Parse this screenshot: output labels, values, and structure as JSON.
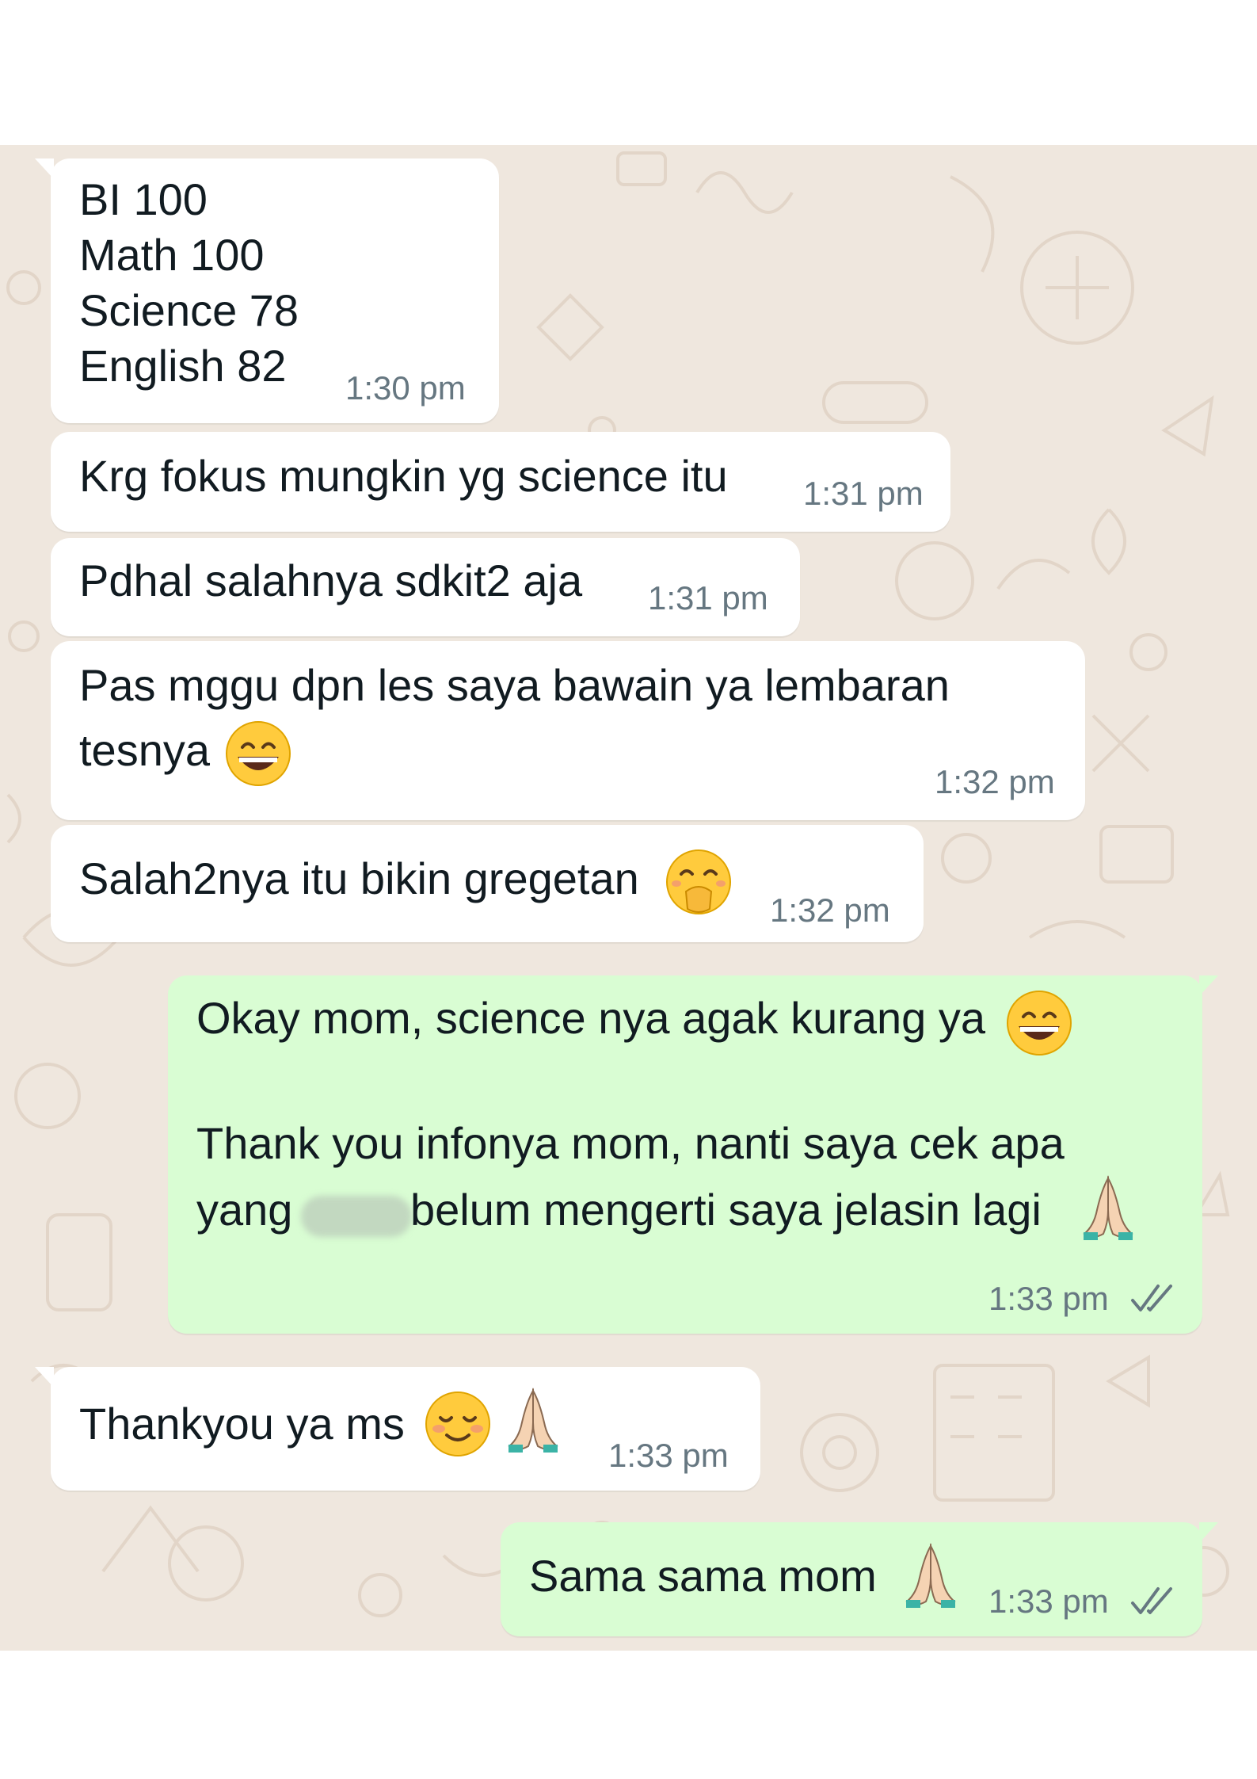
{
  "messages": [
    {
      "direction": "incoming",
      "lines": [
        "BI 100",
        "Math 100",
        "Science 78",
        "English 82"
      ],
      "time": "1:30 pm"
    },
    {
      "direction": "incoming",
      "lines": [
        "Krg fokus mungkin yg science itu"
      ],
      "time": "1:31 pm"
    },
    {
      "direction": "incoming",
      "lines": [
        "Pdhal salahnya sdkit2 aja"
      ],
      "time": "1:31 pm"
    },
    {
      "direction": "incoming",
      "lines": [
        "Pas mggu dpn les saya bawain ya lembaran",
        "tesnya"
      ],
      "emoji": [
        "grinning-face"
      ],
      "time": "1:32 pm"
    },
    {
      "direction": "incoming",
      "lines": [
        "Salah2nya itu bikin gregetan"
      ],
      "emoji": [
        "face-with-hand-over-mouth"
      ],
      "time": "1:32 pm"
    },
    {
      "direction": "outgoing",
      "lines": [
        "Okay mom, science nya agak kurang ya",
        "",
        "Thank you infonya mom, nanti saya cek apa",
        "yang",
        "belum mengerti saya jelasin lagi"
      ],
      "emoji": [
        "grinning-face",
        "folded-hands"
      ],
      "time": "1:33 pm",
      "status": "read"
    },
    {
      "direction": "incoming",
      "lines": [
        "Thankyou ya ms"
      ],
      "emoji": [
        "smiling-face",
        "folded-hands"
      ],
      "time": "1:33 pm"
    },
    {
      "direction": "outgoing",
      "lines": [
        "Sama sama mom"
      ],
      "emoji": [
        "folded-hands"
      ],
      "time": "1:33 pm",
      "status": "read"
    }
  ],
  "colors": {
    "chat_background": "#efe7de",
    "incoming_bubble": "#ffffff",
    "outgoing_bubble": "#d9fdd3",
    "timestamp": "#667781",
    "read_ticks": "#667781"
  }
}
